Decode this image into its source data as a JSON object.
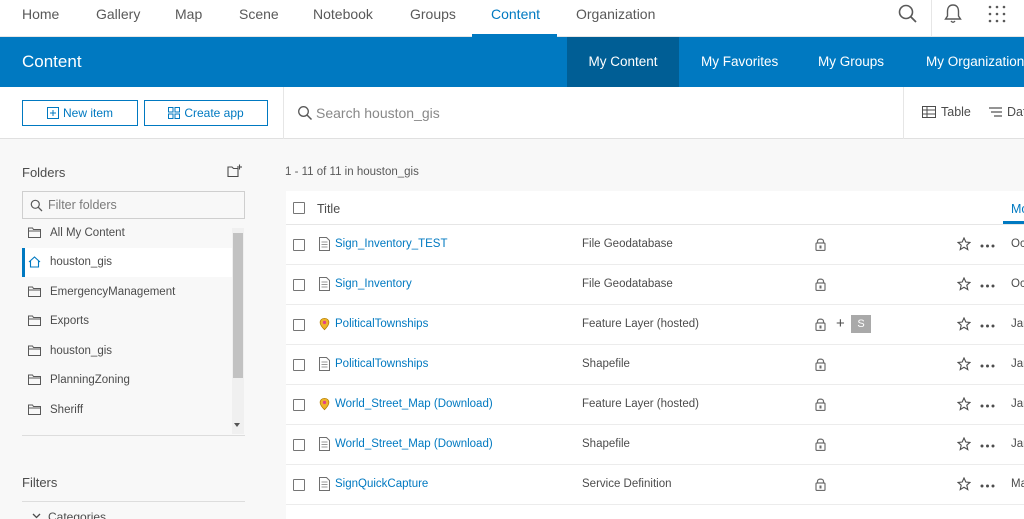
{
  "topnav": {
    "items": [
      "Home",
      "Gallery",
      "Map",
      "Scene",
      "Notebook",
      "Groups",
      "Content",
      "Organization"
    ],
    "active": "Content",
    "icons": [
      "search-icon",
      "bell-icon",
      "apps-grid-icon"
    ]
  },
  "header": {
    "title": "Content",
    "tabs": [
      "My Content",
      "My Favorites",
      "My Groups",
      "My Organization"
    ],
    "active_tab": "My Content"
  },
  "toolbar": {
    "new_item": "New item",
    "create_app": "Create app",
    "search_placeholder": "Search houston_gis",
    "view_table": "Table",
    "view_sort": "Dat"
  },
  "folders": {
    "title": "Folders",
    "filter_placeholder": "Filter folders",
    "items": [
      {
        "label": "All My Content",
        "icon": "folder-icon"
      },
      {
        "label": "houston_gis",
        "icon": "home-icon",
        "active": true
      },
      {
        "label": "EmergencyManagement",
        "icon": "folder-icon"
      },
      {
        "label": "Exports",
        "icon": "folder-icon"
      },
      {
        "label": "houston_gis",
        "icon": "folder-icon"
      },
      {
        "label": "PlanningZoning",
        "icon": "folder-icon"
      },
      {
        "label": "Sheriff",
        "icon": "folder-icon"
      }
    ]
  },
  "filters": {
    "title": "Filters",
    "categories": "Categories"
  },
  "results": {
    "count": "1 - 11 of 11 in houston_gis",
    "columns": {
      "title": "Title",
      "modified": "Mo"
    },
    "rows": [
      {
        "title": "Sign_Inventory_TEST",
        "type": "File Geodatabase",
        "icon": "document-icon",
        "date": "Oc",
        "shared": false
      },
      {
        "title": "Sign_Inventory",
        "type": "File Geodatabase",
        "icon": "document-icon",
        "date": "Oc",
        "shared": false
      },
      {
        "title": "PoliticalTownships",
        "type": "Feature Layer (hosted)",
        "icon": "feature-layer-icon",
        "date": "Jar",
        "shared": true,
        "badge": "S"
      },
      {
        "title": "PoliticalTownships",
        "type": "Shapefile",
        "icon": "document-icon",
        "date": "Jar",
        "shared": false
      },
      {
        "title": "World_Street_Map (Download)",
        "type": "Feature Layer (hosted)",
        "icon": "feature-layer-icon",
        "date": "Jar",
        "shared": false
      },
      {
        "title": "World_Street_Map (Download)",
        "type": "Shapefile",
        "icon": "document-icon",
        "date": "Jar",
        "shared": false
      },
      {
        "title": "SignQuickCapture",
        "type": "Service Definition",
        "icon": "document-icon",
        "date": "Ma",
        "shared": false
      }
    ]
  },
  "colors": {
    "brand": "#0079c1",
    "brand_dark": "#005e95",
    "layer_icon": "#f0b428"
  }
}
